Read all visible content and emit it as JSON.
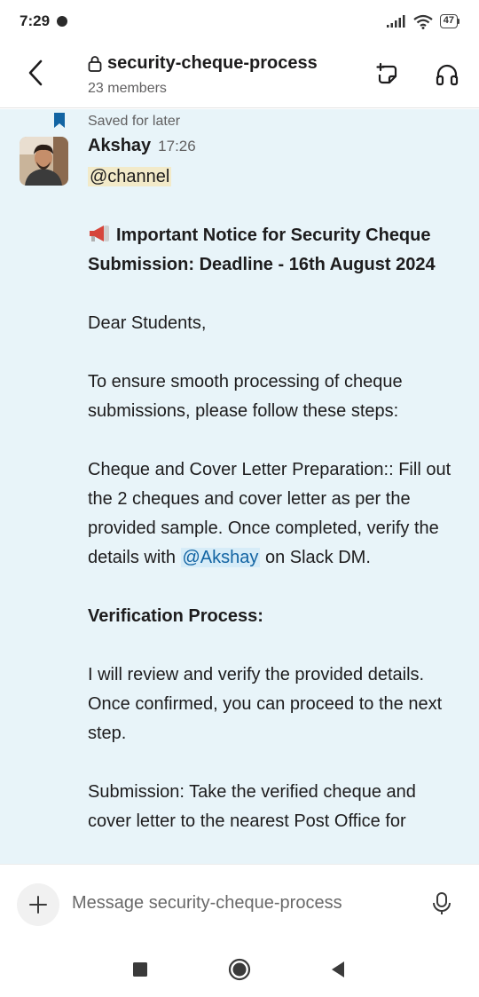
{
  "status_bar": {
    "time": "7:29",
    "battery": "47"
  },
  "header": {
    "channel_name": "security-cheque-process",
    "members": "23 members"
  },
  "message": {
    "saved_label": "Saved for later",
    "sender": "Akshay",
    "time": "17:26",
    "mention_channel": "@channel",
    "notice_title": "Important Notice for Security Cheque Submission: Deadline - 16th August 2024",
    "greeting": "Dear Students,",
    "intro": "To ensure smooth processing of cheque submissions, please follow these steps:",
    "step1_prefix": "Cheque and Cover Letter Preparation:: Fill out the 2 cheques and cover letter as per the provided sample. Once completed, verify the details with",
    "step1_mention": "@Akshay",
    "step1_suffix": "on Slack DM.",
    "verification_heading": "Verification Process:",
    "verification_text": "I will review and verify the provided details. Once confirmed, you can proceed to the next step.",
    "submission_text": "Submission: Take the verified cheque and cover letter to the nearest Post Office for"
  },
  "composer": {
    "placeholder": "Message security-cheque-process"
  },
  "icons": {
    "back": "chevron-left-icon",
    "lock": "lock-icon",
    "canvas": "canvas-icon",
    "huddle": "headphones-icon",
    "bookmark": "bookmark-icon",
    "megaphone": "megaphone-icon",
    "plus": "plus-icon",
    "mic": "microphone-icon"
  },
  "colors": {
    "message_bg": "#e8f4f9",
    "mention_user": "#1264a3",
    "mention_channel_bg": "#f2eac9",
    "bookmark": "#1264a3"
  }
}
